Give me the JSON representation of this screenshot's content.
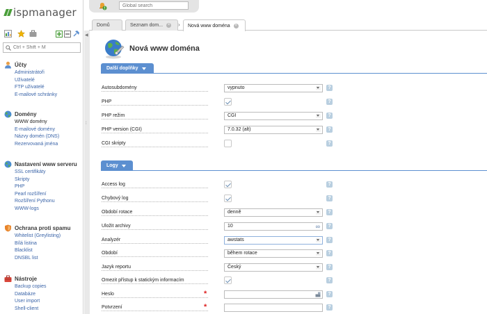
{
  "app": {
    "brand": "ispmanager",
    "shortcut_hint": "Ctrl + Shift + M",
    "global_search_placeholder": "Global search"
  },
  "colors": {
    "accent": "#5c8fd0",
    "link": "#3a64a8",
    "brand_green": "#4a9e3a",
    "required": "#dd2222"
  },
  "sidebar": {
    "toolbar_icons": [
      "dashboard-icon",
      "star-icon",
      "briefcase-icon",
      "expand-all-icon",
      "collapse-all-icon",
      "pin-icon"
    ],
    "groups": [
      {
        "title": "Účty",
        "icon": "user-icon",
        "items": [
          "Administrátoři",
          "Uživatelé",
          "FTP uživatelé",
          "E-mailové schránky"
        ]
      },
      {
        "title": "Domény",
        "icon": "globe-icon",
        "items": [
          "WWW domény",
          "E-mailové domény",
          "Názvy domén (DNS)",
          "Rezervovaná jména"
        ]
      },
      {
        "title": "Nastavení www serveru",
        "icon": "web-server-icon",
        "items": [
          "SSL certifikáty",
          "Skripty",
          "PHP",
          "Pearl rozšíření",
          "Rozšíření Pythonu",
          "WWW-logs"
        ]
      },
      {
        "title": "Ochrana proti spamu",
        "icon": "shield-icon",
        "items": [
          "Whitelist (Greylisting)",
          "Bílá listina",
          "Blacklist",
          "DNSBL list"
        ]
      },
      {
        "title": "Nástroje",
        "icon": "tools-icon",
        "items": [
          "Backup copies",
          "Databáze",
          "User import",
          "Shell-client"
        ]
      }
    ]
  },
  "tabs": [
    {
      "label": "Domů",
      "closable": false
    },
    {
      "label": "Seznam dom...",
      "closable": true
    },
    {
      "label": "Nová www doména",
      "closable": true
    }
  ],
  "page": {
    "title": "Nová www doména"
  },
  "sections": [
    {
      "title": "Další doplňky",
      "fields": [
        {
          "label": "Autosubdomény",
          "type": "select",
          "value": "vypnuto"
        },
        {
          "label": "PHP",
          "type": "checkbox",
          "checked": true
        },
        {
          "label": "PHP režim",
          "type": "select",
          "value": "CGI"
        },
        {
          "label": "PHP version (CGI)",
          "type": "select",
          "value": "7.0.32 (alt)"
        },
        {
          "label": "CGI skripty",
          "type": "checkbox",
          "checked": false
        }
      ]
    },
    {
      "title": "Logy",
      "fields": [
        {
          "label": "Access log",
          "type": "checkbox",
          "checked": true
        },
        {
          "label": "Chybový log",
          "type": "checkbox",
          "checked": true
        },
        {
          "label": "Období rotace",
          "type": "select",
          "value": "denně"
        },
        {
          "label": "Uložit archivy",
          "type": "text",
          "value": "10",
          "suffix_icon": "infinity-icon"
        },
        {
          "label": "Analyzér",
          "type": "select",
          "value": "awstats"
        },
        {
          "label": "Období",
          "type": "select",
          "value": "během rotace"
        },
        {
          "label": "Jazyk reportu",
          "type": "select",
          "value": "Český"
        },
        {
          "label": "Omezit přístup k statickým informacím",
          "type": "checkbox",
          "checked": true
        },
        {
          "label": "Heslo",
          "type": "password",
          "value": "",
          "required": true,
          "suffix_icon": "key-icon"
        },
        {
          "label": "Potvrzení",
          "type": "password",
          "value": "",
          "required": true
        }
      ]
    }
  ]
}
